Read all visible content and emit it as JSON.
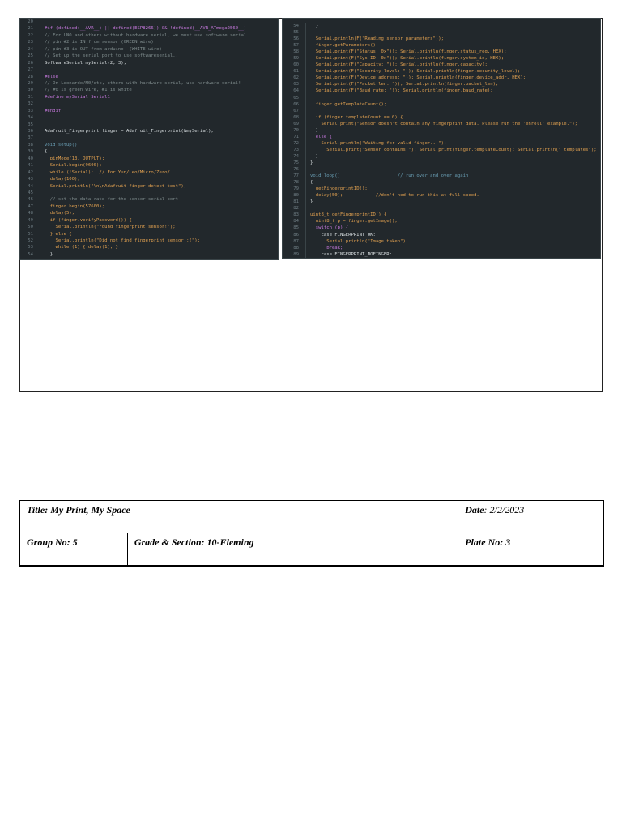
{
  "code_left": [
    {
      "n": "20",
      "t": "",
      "c": "plain"
    },
    {
      "n": "21",
      "t": "#if (defined(__AVR__) || defined(ESP8266)) && !defined(__AVR_ATmega2560__)",
      "c": "pre"
    },
    {
      "n": "22",
      "t": "// For UNO and others without hardware serial, we must use software serial...",
      "c": "com"
    },
    {
      "n": "23",
      "t": "// pin #2 is IN from sensor (GREEN wire)",
      "c": "com"
    },
    {
      "n": "24",
      "t": "// pin #3 is OUT from arduino  (WHITE wire)",
      "c": "com"
    },
    {
      "n": "25",
      "t": "// Set up the serial port to use softwareserial..",
      "c": "com"
    },
    {
      "n": "26",
      "t": "SoftwareSerial mySerial(2, 3);",
      "c": "plain"
    },
    {
      "n": "27",
      "t": "",
      "c": "plain"
    },
    {
      "n": "28",
      "t": "#else",
      "c": "pre"
    },
    {
      "n": "29",
      "t": "// On Leonardo/M0/etc, others with hardware serial, use hardware serial!",
      "c": "com"
    },
    {
      "n": "30",
      "t": "// #0 is green wire, #1 is white",
      "c": "com"
    },
    {
      "n": "31",
      "t": "#define mySerial Serial1",
      "c": "pre"
    },
    {
      "n": "32",
      "t": "",
      "c": "plain"
    },
    {
      "n": "33",
      "t": "#endif",
      "c": "pre"
    },
    {
      "n": "34",
      "t": "",
      "c": "plain"
    },
    {
      "n": "35",
      "t": "",
      "c": "plain"
    },
    {
      "n": "36",
      "t": "Adafruit_Fingerprint finger = Adafruit_Fingerprint(&mySerial);",
      "c": "plain"
    },
    {
      "n": "37",
      "t": "",
      "c": "plain"
    },
    {
      "n": "38",
      "t": "void setup()",
      "c": "kw"
    },
    {
      "n": "39",
      "t": "{",
      "c": "plain"
    },
    {
      "n": "40",
      "t": "  pinMode(13, OUTPUT);",
      "c": "code"
    },
    {
      "n": "41",
      "t": "  Serial.begin(9600);",
      "c": "code"
    },
    {
      "n": "42",
      "t": "  while (!Serial);  // For Yun/Leo/Micro/Zero/...",
      "c": "code"
    },
    {
      "n": "43",
      "t": "  delay(100);",
      "c": "code"
    },
    {
      "n": "44",
      "t": "  Serial.println(\"\\n\\nAdafruit finger detect test\");",
      "c": "code"
    },
    {
      "n": "45",
      "t": "",
      "c": "plain"
    },
    {
      "n": "46",
      "t": "  // set the data rate for the sensor serial port",
      "c": "com"
    },
    {
      "n": "47",
      "t": "  finger.begin(57600);",
      "c": "code"
    },
    {
      "n": "48",
      "t": "  delay(5);",
      "c": "code"
    },
    {
      "n": "49",
      "t": "  if (finger.verifyPassword()) {",
      "c": "code"
    },
    {
      "n": "50",
      "t": "    Serial.println(\"Found fingerprint sensor!\");",
      "c": "code"
    },
    {
      "n": "51",
      "t": "  } else {",
      "c": "code"
    },
    {
      "n": "52",
      "t": "    Serial.println(\"Did not find fingerprint sensor :(\");",
      "c": "code"
    },
    {
      "n": "53",
      "t": "    while (1) { delay(1); }",
      "c": "code"
    },
    {
      "n": "54",
      "t": "  }",
      "c": "plain"
    }
  ],
  "code_right": [
    {
      "n": "54",
      "t": "  }",
      "c": "plain"
    },
    {
      "n": "55",
      "t": "",
      "c": "plain"
    },
    {
      "n": "56",
      "t": "  Serial.println(F(\"Reading sensor parameters\"));",
      "c": "code"
    },
    {
      "n": "57",
      "t": "  finger.getParameters();",
      "c": "code"
    },
    {
      "n": "58",
      "t": "  Serial.print(F(\"Status: 0x\")); Serial.println(finger.status_reg, HEX);",
      "c": "code"
    },
    {
      "n": "59",
      "t": "  Serial.print(F(\"Sys ID: 0x\")); Serial.println(finger.system_id, HEX);",
      "c": "code"
    },
    {
      "n": "60",
      "t": "  Serial.print(F(\"Capacity: \")); Serial.println(finger.capacity);",
      "c": "code"
    },
    {
      "n": "61",
      "t": "  Serial.print(F(\"Security level: \")); Serial.println(finger.security_level);",
      "c": "code"
    },
    {
      "n": "62",
      "t": "  Serial.print(F(\"Device address: \")); Serial.println(finger.device_addr, HEX);",
      "c": "code"
    },
    {
      "n": "63",
      "t": "  Serial.print(F(\"Packet len: \")); Serial.println(finger.packet_len);",
      "c": "code"
    },
    {
      "n": "64",
      "t": "  Serial.print(F(\"Baud rate: \")); Serial.println(finger.baud_rate);",
      "c": "code"
    },
    {
      "n": "65",
      "t": "",
      "c": "plain"
    },
    {
      "n": "66",
      "t": "  finger.getTemplateCount();",
      "c": "code"
    },
    {
      "n": "67",
      "t": "",
      "c": "plain"
    },
    {
      "n": "68",
      "t": "  if (finger.templateCount == 0) {",
      "c": "code"
    },
    {
      "n": "69",
      "t": "    Serial.print(\"Sensor doesn't contain any fingerprint data. Please run the 'enroll' example.\");",
      "c": "code"
    },
    {
      "n": "70",
      "t": "  }",
      "c": "plain"
    },
    {
      "n": "71",
      "t": "  else {",
      "c": "pre"
    },
    {
      "n": "72",
      "t": "    Serial.println(\"Waiting for valid finger...\");",
      "c": "code"
    },
    {
      "n": "73",
      "t": "      Serial.print(\"Sensor contains \"); Serial.print(finger.templateCount); Serial.println(\" templates\");",
      "c": "code"
    },
    {
      "n": "74",
      "t": "  }",
      "c": "plain"
    },
    {
      "n": "75",
      "t": "}",
      "c": "plain"
    },
    {
      "n": "76",
      "t": "",
      "c": "plain"
    },
    {
      "n": "77",
      "t": "void loop()                     // run over and over again",
      "c": "kw"
    },
    {
      "n": "78",
      "t": "{",
      "c": "plain"
    },
    {
      "n": "79",
      "t": "  getFingerprintID();",
      "c": "code"
    },
    {
      "n": "80",
      "t": "  delay(50);            //don't ned to run this at full speed.",
      "c": "code"
    },
    {
      "n": "81",
      "t": "}",
      "c": "plain"
    },
    {
      "n": "82",
      "t": "",
      "c": "plain"
    },
    {
      "n": "83",
      "t": "uint8_t getFingerprintID() {",
      "c": "code"
    },
    {
      "n": "84",
      "t": "  uint8_t p = finger.getImage();",
      "c": "code"
    },
    {
      "n": "85",
      "t": "  switch (p) {",
      "c": "pre"
    },
    {
      "n": "86",
      "t": "    case FINGERPRINT_OK:",
      "c": "plain"
    },
    {
      "n": "87",
      "t": "      Serial.println(\"Image taken\");",
      "c": "code"
    },
    {
      "n": "88",
      "t": "      break;",
      "c": "pre"
    },
    {
      "n": "89",
      "t": "    case FINGERPRINT_NOFINGER:",
      "c": "plain"
    }
  ],
  "info_table": {
    "title_label": "Title: My Print, My Space",
    "date_label": "Date",
    "date_value": ": 2/2/2023",
    "group": "Group No: 5",
    "grade_section": "Grade & Section: 10-Fleming",
    "plate": "Plate No: 3"
  }
}
